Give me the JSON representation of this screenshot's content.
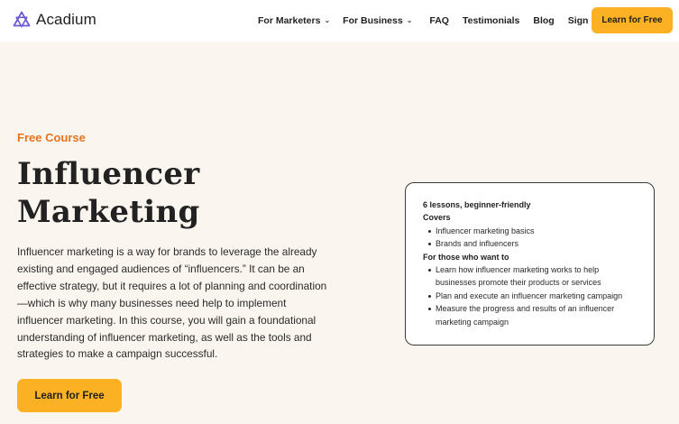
{
  "header": {
    "brand": "Acadium",
    "nav": [
      {
        "label": "For Marketers",
        "has_dropdown": true
      },
      {
        "label": "For Business",
        "has_dropdown": true
      },
      {
        "label": "FAQ"
      },
      {
        "label": "Testimonials"
      },
      {
        "label": "Blog"
      },
      {
        "label": "Sign In"
      }
    ],
    "cta_label": "Learn for Free",
    "icons": {
      "logo": "acadium-logo-icon",
      "dropdown": "chevron-down-icon"
    }
  },
  "hero": {
    "eyebrow": "Free Course",
    "title": "Influencer Marketing",
    "description": "Influencer marketing is a way for brands to leverage the already existing and engaged audiences of “influencers.” It can be an effective strategy, but it requires a lot of planning and coordination—which is why many businesses need help to implement influencer marketing. In this course, you will gain a foundational understanding of influencer marketing, as well as the tools and strategies to make a campaign successful.",
    "cta_label": "Learn for Free"
  },
  "course_card": {
    "summary": "6 lessons, beginner-friendly",
    "covers_heading": "Covers",
    "covers": [
      "Influencer marketing basics",
      "Brands and influencers"
    ],
    "audience_heading": "For those who want to",
    "audience": [
      "Learn how influencer marketing works to help businesses promote their products or services",
      "Plan and execute an influencer marketing campaign",
      "Measure the progress and results of an influencer marketing campaign"
    ]
  },
  "colors": {
    "accent": "#fbb123",
    "eyebrow": "#e8731c",
    "background": "#faf5ef",
    "logo": "#6b5bd6"
  }
}
